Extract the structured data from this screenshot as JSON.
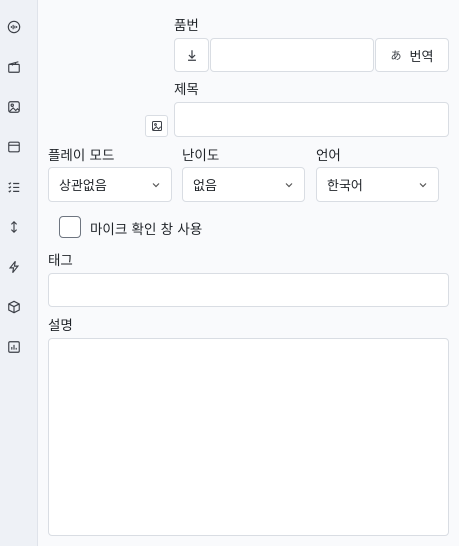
{
  "sidebar": {
    "items": [
      {
        "icon": "audio-wave-icon"
      },
      {
        "icon": "clapperboard-icon"
      },
      {
        "icon": "image-icon"
      },
      {
        "icon": "calendar-icon"
      },
      {
        "icon": "list-check-icon"
      },
      {
        "icon": "arrow-up-down-icon"
      },
      {
        "icon": "lightning-icon"
      },
      {
        "icon": "package-box-icon"
      },
      {
        "icon": "bar-chart-icon"
      }
    ]
  },
  "form": {
    "product_no_label": "품번",
    "product_no_value": "",
    "translate_label": "번역",
    "title_label": "제목",
    "title_value": "",
    "play_mode_label": "플레이 모드",
    "play_mode_value": "상관없음",
    "difficulty_label": "난이도",
    "difficulty_value": "없음",
    "language_label": "언어",
    "language_value": "한국어",
    "mic_confirm_label": "마이크 확인 창 사용",
    "mic_confirm_checked": false,
    "tags_label": "태그",
    "tags_value": "",
    "description_label": "설명",
    "description_value": ""
  }
}
